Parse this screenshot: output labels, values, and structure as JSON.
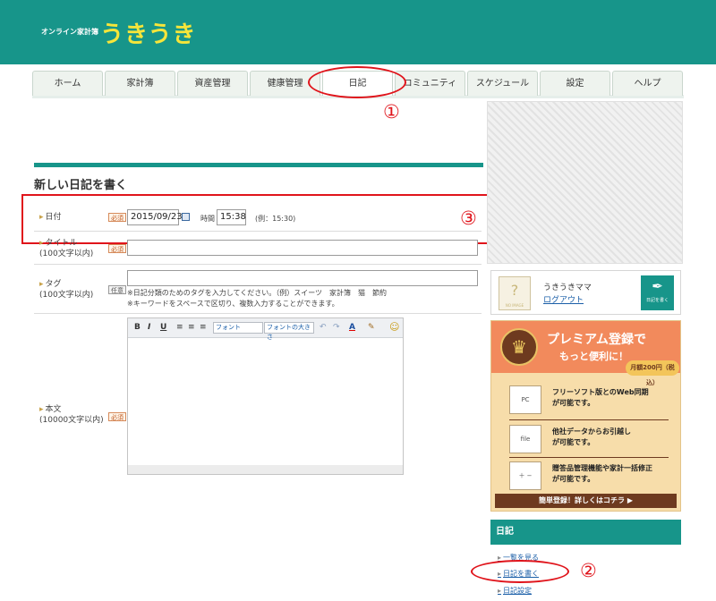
{
  "header": {
    "logo_small": "オンライン家計簿",
    "logo_big": "うきうき"
  },
  "tabs": [
    {
      "label": "ホーム"
    },
    {
      "label": "家計簿"
    },
    {
      "label": "資産管理"
    },
    {
      "label": "健康管理"
    },
    {
      "label": "日記"
    },
    {
      "label": "コミュニティ"
    },
    {
      "label": "スケジュール"
    },
    {
      "label": "設定"
    },
    {
      "label": "ヘルプ"
    }
  ],
  "annotations": {
    "n1": "①",
    "n2": "②",
    "n3": "③",
    "color": "#e0141b"
  },
  "form": {
    "title": "新しい日記を書く",
    "required": "必須",
    "optional": "任意",
    "date": {
      "label": "日付",
      "value": "2015/09/23",
      "time_label": "時間",
      "time_value": "15:38",
      "example": "(例：15:30)"
    },
    "title_field": {
      "label": "タイトル",
      "hint": "(100文字以内)",
      "value": ""
    },
    "tag": {
      "label": "タグ",
      "hint": "(100文字以内)",
      "value": "",
      "note1": "※日記分類のためのタグを入力してください。（例）スイーツ　家計簿　猫　節約",
      "note2": "※キーワードをスペースで区切り、複数入力することができます。"
    },
    "body": {
      "label": "本文",
      "hint": "(10000文字以内)"
    },
    "toolbar": {
      "bold": "B",
      "italic": "I",
      "underline": "U",
      "font": "フォント",
      "font_size": "フォントの大きさ",
      "undo": "↶",
      "redo": "↷",
      "font_color": "A",
      "smiley": "☺"
    }
  },
  "sidebar": {
    "user_name": "うきうきママ",
    "logout": "ログアウト",
    "avatar_text": "NO IMAGE",
    "write_button": "日記を書く",
    "premium": {
      "title": "プレミアム登録で",
      "subtitle": "もっと便利に！",
      "price": "月額200円（税込）",
      "features": [
        {
          "icon": "PC",
          "text1": "フリーソフト版とのWeb同期",
          "text2": "が可能です。"
        },
        {
          "icon": "file",
          "text1": "他社データからお引越し",
          "text2": "が可能です。"
        },
        {
          "icon": "＋ −",
          "text1": "贈答品管理機能や家計一括修正",
          "text2": "が可能です。"
        }
      ],
      "cta": "簡単登録！詳しくはコチラ ▶"
    },
    "diary_header": "日記",
    "links": [
      "一覧を見る",
      "日記を書く",
      "日記設定"
    ]
  },
  "colors": {
    "brand": "#17958a",
    "logo_yellow": "#f6e53a",
    "premium_orange": "#f28a5c"
  }
}
